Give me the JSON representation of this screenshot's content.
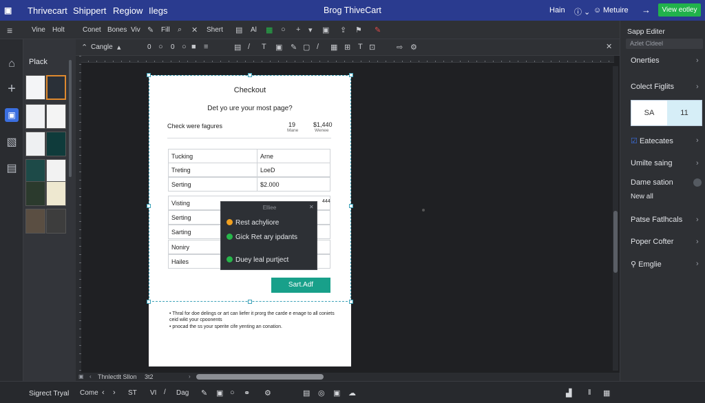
{
  "titlebar": {
    "menu": [
      "Thrivecart",
      "Shippert",
      "Regiow",
      "Ilegs"
    ],
    "doc_title": "Brog ThiveCart",
    "right_items": [
      "Hain",
      "Metuire"
    ],
    "view_button": "View eotley"
  },
  "toolbar1": {
    "items": [
      "Vine",
      "Holt",
      "Conet",
      "Bones",
      "Viv",
      "Fill",
      "Shert",
      "Al"
    ]
  },
  "toolbar2": {
    "canvas_label": "Cangle",
    "zero1": "0",
    "zero2": "0"
  },
  "left_panel": {
    "title": "Plack"
  },
  "page": {
    "title": "Checkout",
    "subtitle": "Det yo ure your most page?",
    "row_label": "Check were fagures",
    "stat1_value": "19",
    "stat1_label": "Mane",
    "stat2_value": "$1,440",
    "stat2_label": "Wenee",
    "table1": [
      [
        "Tucking",
        "Arne"
      ],
      [
        "Treting",
        "LoeD"
      ],
      [
        "Serting",
        "$2.000"
      ]
    ],
    "table2": [
      "Visting",
      "Serting",
      "Sarting",
      "Noniry",
      "Hailes"
    ],
    "table2_right": "444",
    "start_button": "Sart.Adf",
    "notes": [
      "Thral for doe delings or art can liefer it prorg the carde e enage to all coniets ceid wikt your cpoonents",
      "pnocad the ss your sperite cife yenting an conation."
    ]
  },
  "popup": {
    "title": "Elliee",
    "items": [
      {
        "icon": "warning-dot-icon",
        "label": "Rest achyliore",
        "color": "#f0a020"
      },
      {
        "icon": "check-icon",
        "label": "Gick Ret ary ipdants",
        "color": "#26b64a"
      },
      {
        "icon": "check-icon",
        "label": "Duey leal purtject",
        "color": "#26b64a"
      }
    ]
  },
  "right_panel": {
    "header": "Sapp Editer",
    "field": "Azlet Cldeel",
    "items": [
      "Onerties",
      "Colect Figlits",
      "Eatecates",
      "Umilte saing",
      "Dame sation",
      "New all",
      "Patse Fatlhcals",
      "Poper Cofter",
      "Emglie"
    ],
    "card_left": "SA",
    "card_right": "11"
  },
  "statusbar": {
    "left": "Sigrect Tryal",
    "come": "Come",
    "st": "ST",
    "vi": "VI",
    "dag": "Dag"
  },
  "hscroll": {
    "label": "Thnlectlt Sllon",
    "num": "3t2"
  }
}
